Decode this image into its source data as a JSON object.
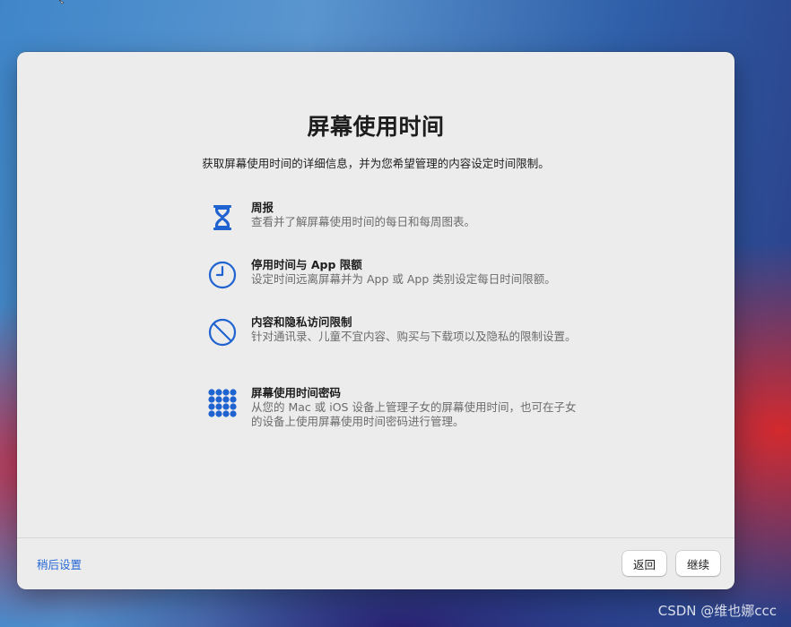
{
  "dialog": {
    "title": "屏幕使用时间",
    "subtitle": "获取屏幕使用时间的详细信息，并为您希望管理的内容设定时间限制。"
  },
  "features": [
    {
      "icon": "hourglass-icon",
      "title": "周报",
      "description": "查看并了解屏幕使用时间的每日和每周图表。"
    },
    {
      "icon": "clock-icon",
      "title": "停用时间与 App 限额",
      "description": "设定时间远离屏幕并为 App 或 App 类别设定每日时间限额。"
    },
    {
      "icon": "prohibited-icon",
      "title": "内容和隐私访问限制",
      "description": "针对通讯录、儿童不宜内容、购买与下载项以及隐私的限制设置。"
    },
    {
      "icon": "keypad-icon",
      "title": "屏幕使用时间密码",
      "description": "从您的 Mac 或 iOS 设备上管理子女的屏幕使用时间，也可在子女的设备上使用屏幕使用时间密码进行管理。"
    }
  ],
  "footer": {
    "later_label": "稍后设置",
    "back_label": "返回",
    "continue_label": "继续"
  },
  "watermark": "CSDN @维也娜ccc",
  "colors": {
    "accent": "#1f63d1",
    "link": "#2467d6",
    "sheet_background": "#ececec"
  }
}
